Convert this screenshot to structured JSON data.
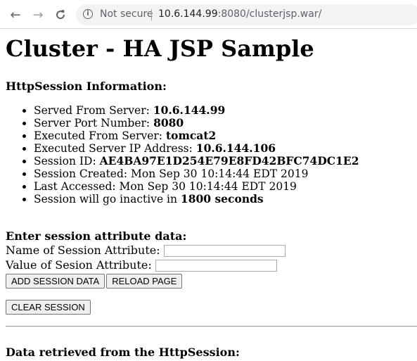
{
  "browser": {
    "security_label": "Not secure",
    "url_host": "10.6.144.99",
    "url_rest": ":8080/clusterjsp.war/"
  },
  "page": {
    "title": "Cluster - HA JSP Sample",
    "session_info_heading": "HttpSession Information:",
    "info": {
      "served_from_label": "Served From Server: ",
      "served_from_value": "10.6.144.99",
      "port_label": "Server Port Number: ",
      "port_value": "8080",
      "executed_from_label": "Executed From Server: ",
      "executed_from_value": "tomcat2",
      "executed_ip_label": "Executed Server IP Address: ",
      "executed_ip_value": "10.6.144.106",
      "session_id_label": "Session ID: ",
      "session_id_value": "AE4BA97E1D254E79E8FD42BFC74DC1E2",
      "session_created": "Session Created: Mon Sep 30 10:14:44 EDT 2019",
      "last_accessed": "Last Accessed: Mon Sep 30 10:14:44 EDT 2019",
      "inactive_label": "Session will go inactive in ",
      "inactive_value": "1800 seconds"
    },
    "form": {
      "heading": "Enter session attribute data:",
      "name_label": "Name of Session Attribute:",
      "name_value": "",
      "value_label": "Value of Sesion Attribute:",
      "value_value": "",
      "add_button": "ADD SESSION DATA",
      "reload_button": "RELOAD PAGE",
      "clear_button": "CLEAR SESSION"
    },
    "retrieved_heading": "Data retrieved from the HttpSession:"
  }
}
